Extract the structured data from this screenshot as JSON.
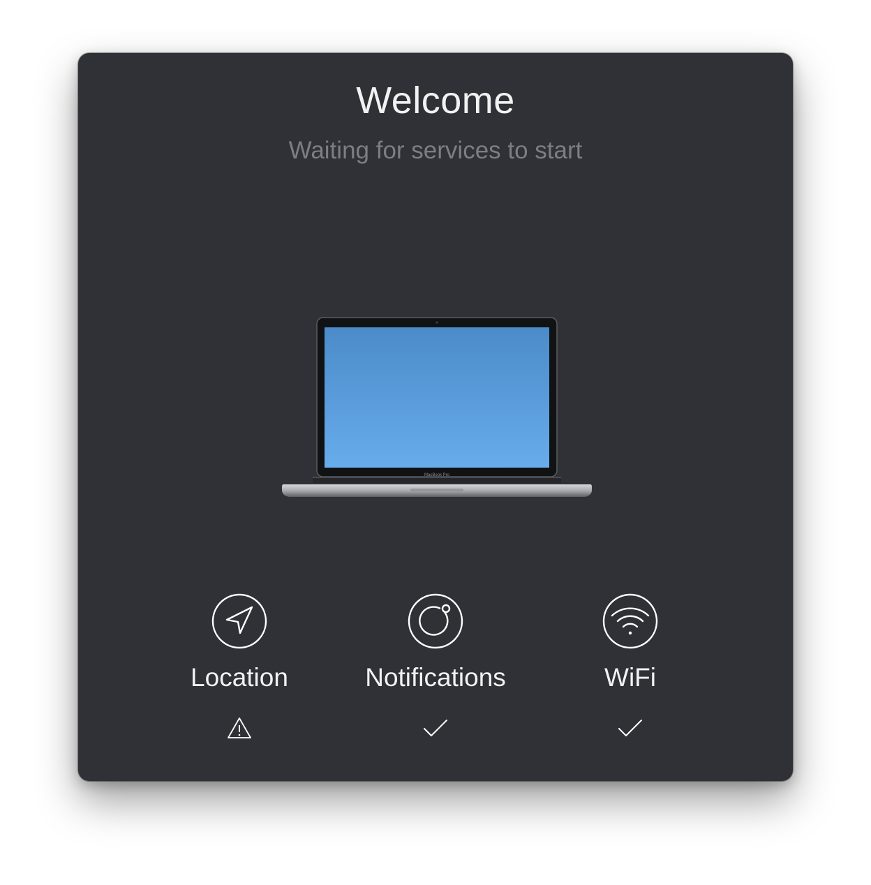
{
  "dialog": {
    "title": "Welcome",
    "subtitle": "Waiting for services to start",
    "illustration": {
      "icon": "macbook-pro-icon",
      "screen_color_top": "#4b8bc9",
      "screen_color_bottom": "#68acec",
      "device_label": "MacBook Pro"
    }
  },
  "services": [
    {
      "label": "Location",
      "icon": "location-arrow-icon",
      "status": "warning",
      "status_icon": "warning-triangle-icon"
    },
    {
      "label": "Notifications",
      "icon": "notification-ring-icon",
      "status": "ok",
      "status_icon": "checkmark-icon"
    },
    {
      "label": "WiFi",
      "icon": "wifi-icon",
      "status": "ok",
      "status_icon": "checkmark-icon"
    }
  ],
  "colors": {
    "window_background": "#2f3136",
    "title_text": "#f2f2f2",
    "subtitle_text": "#7b7e84",
    "icon_stroke": "#ffffff"
  }
}
